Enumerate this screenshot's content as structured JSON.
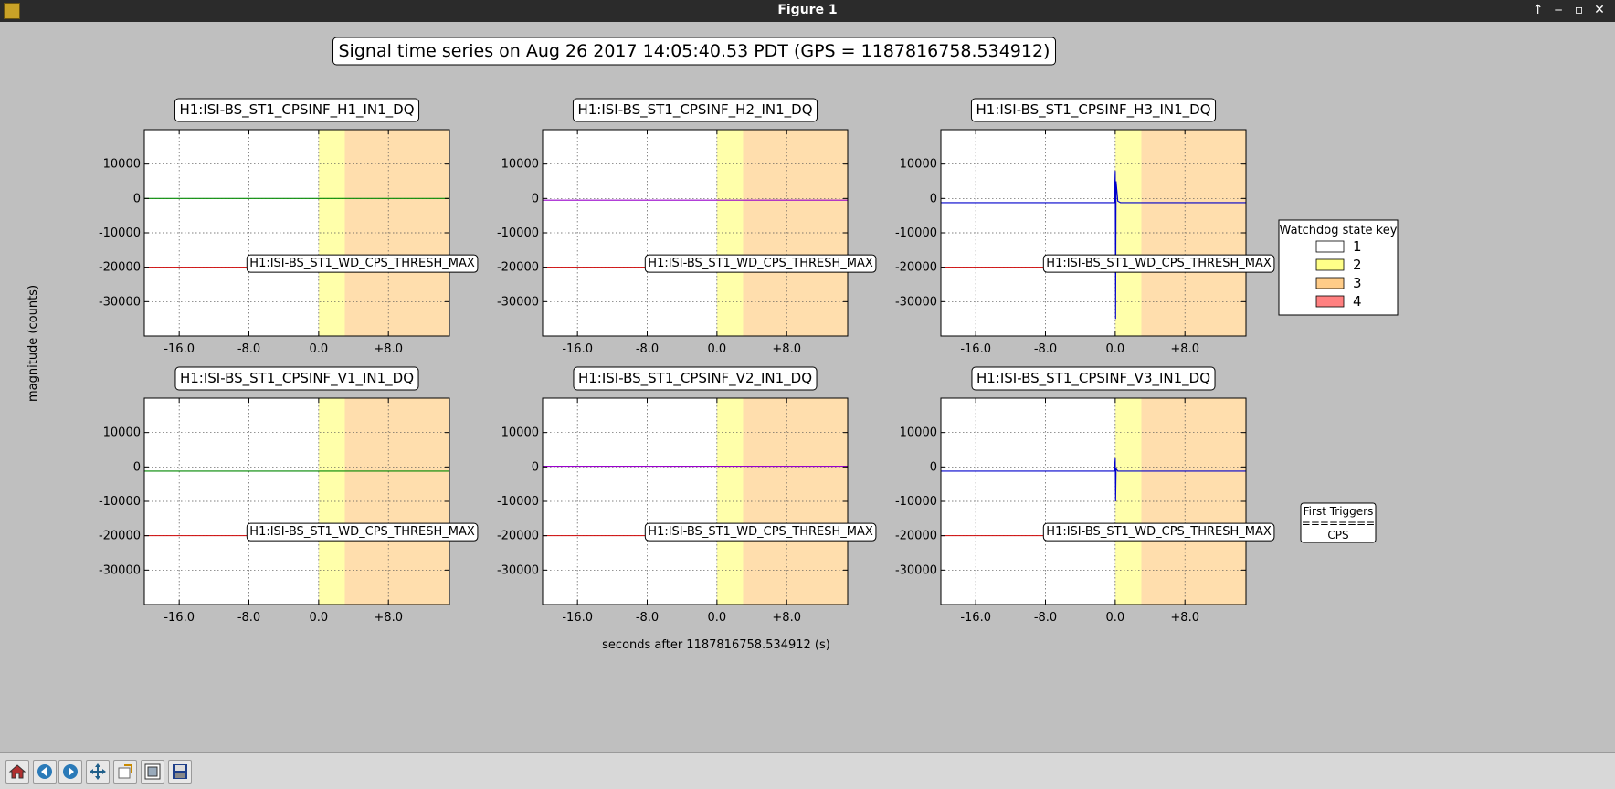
{
  "window": {
    "title": "Figure 1",
    "controls": [
      "↑",
      "‒",
      "▫",
      "✕"
    ]
  },
  "toolbar": {
    "buttons": [
      {
        "name": "home-icon"
      },
      {
        "name": "back-icon"
      },
      {
        "name": "forward-icon"
      },
      {
        "name": "pan-icon"
      },
      {
        "name": "zoom-icon"
      },
      {
        "name": "subplots-icon"
      },
      {
        "name": "save-icon"
      }
    ]
  },
  "chart_data": {
    "type": "line",
    "title": "Signal time series on Aug 26 2017 14:05:40.53 PDT (GPS = 1187816758.534912)",
    "xlabel": "seconds after 1187816758.534912 (s)",
    "ylabel": "magnitude (counts)",
    "xlim": [
      -20,
      15
    ],
    "ylim": [
      -40000,
      20000
    ],
    "xticks": [
      -16,
      -8,
      0,
      8
    ],
    "xtick_labels": [
      "-16.0",
      "-8.0",
      "0.0",
      "+8.0"
    ],
    "yticks": [
      10000,
      0,
      -10000,
      -20000,
      -30000
    ],
    "ytick_labels": [
      "10000",
      "0",
      "-10000",
      "-20000",
      "-30000"
    ],
    "grid": true,
    "threshold": {
      "label": "H1:ISI-BS_ST1_WD_CPS_THRESH_MAX",
      "value": -20000,
      "color": "#cc0000"
    },
    "state_bands": [
      {
        "state": 1,
        "from": -20,
        "to": 0,
        "color": "#ffffff"
      },
      {
        "state": 2,
        "from": 0,
        "to": 3,
        "color": "#ffffaa"
      },
      {
        "state": 3,
        "from": 3,
        "to": 15,
        "color": "#ffdead"
      }
    ],
    "panels": [
      {
        "title": "H1:ISI-BS_ST1_CPSINF_H1_IN1_DQ",
        "color": "#008800",
        "points": [
          [
            -20,
            0
          ],
          [
            0,
            0
          ],
          [
            15,
            0
          ]
        ]
      },
      {
        "title": "H1:ISI-BS_ST1_CPSINF_H2_IN1_DQ",
        "color": "#9900cc",
        "points": [
          [
            -20,
            -500
          ],
          [
            0,
            -500
          ],
          [
            15,
            -500
          ]
        ]
      },
      {
        "title": "H1:ISI-BS_ST1_CPSINF_H3_IN1_DQ",
        "color": "#0000cc",
        "points": [
          [
            -20,
            -1200
          ],
          [
            -0.1,
            -1200
          ],
          [
            0,
            8000
          ],
          [
            0.05,
            -35000
          ],
          [
            0.1,
            5000
          ],
          [
            0.3,
            -800
          ],
          [
            0.6,
            -1200
          ],
          [
            15,
            -1200
          ]
        ]
      },
      {
        "title": "H1:ISI-BS_ST1_CPSINF_V1_IN1_DQ",
        "color": "#008800",
        "points": [
          [
            -20,
            -1200
          ],
          [
            0,
            -1200
          ],
          [
            15,
            -1200
          ]
        ]
      },
      {
        "title": "H1:ISI-BS_ST1_CPSINF_V2_IN1_DQ",
        "color": "#9900cc",
        "points": [
          [
            -20,
            200
          ],
          [
            0,
            200
          ],
          [
            15,
            200
          ]
        ]
      },
      {
        "title": "H1:ISI-BS_ST1_CPSINF_V3_IN1_DQ",
        "color": "#0000cc",
        "points": [
          [
            -20,
            -1200
          ],
          [
            -0.1,
            -1200
          ],
          [
            0,
            2500
          ],
          [
            0.05,
            -10000
          ],
          [
            0.1,
            -500
          ],
          [
            0.3,
            -1200
          ],
          [
            15,
            -1200
          ]
        ]
      }
    ],
    "legend": {
      "title": "Watchdog state key",
      "placement": "right",
      "items": [
        {
          "label": "1",
          "color": "#ffffff"
        },
        {
          "label": "2",
          "color": "#ffff88"
        },
        {
          "label": "3",
          "color": "#ffcc88"
        },
        {
          "label": "4",
          "color": "#ff8080"
        }
      ]
    },
    "first_triggers": {
      "title": "First Triggers",
      "separator": "========",
      "value": "CPS"
    }
  }
}
